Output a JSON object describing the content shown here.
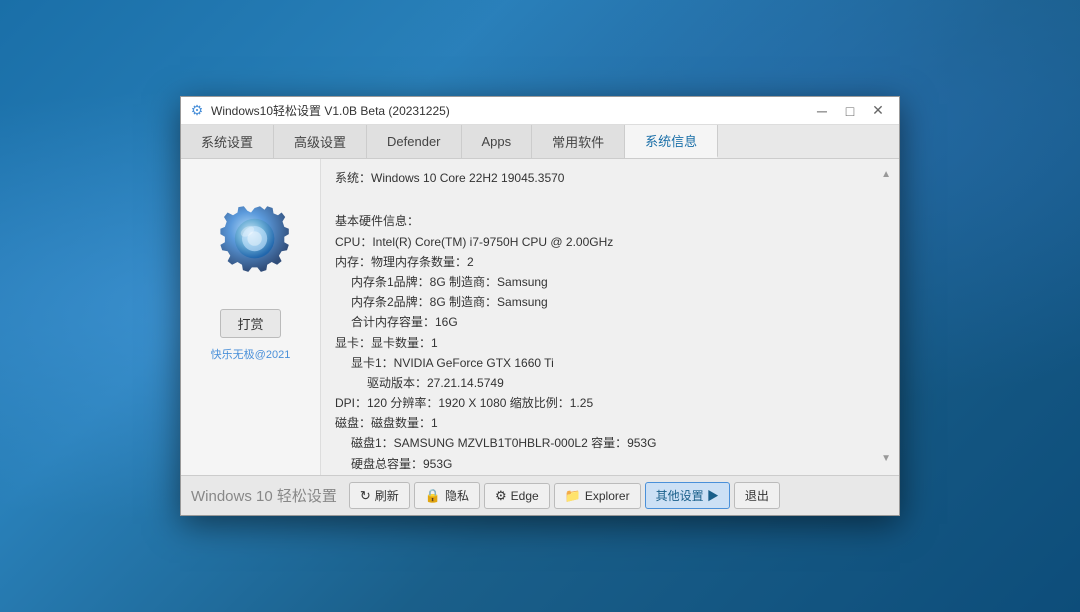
{
  "window": {
    "title": "Windows10轻松设置 V1.0B Beta (20231225)",
    "icon": "⚙",
    "minimize_label": "─",
    "maximize_label": "□",
    "close_label": "✕"
  },
  "tabs": [
    {
      "id": "system",
      "label": "系统设置",
      "active": false
    },
    {
      "id": "advanced",
      "label": "高级设置",
      "active": false
    },
    {
      "id": "defender",
      "label": "Defender",
      "active": false
    },
    {
      "id": "apps",
      "label": "Apps",
      "active": false
    },
    {
      "id": "tools",
      "label": "常用软件",
      "active": false
    },
    {
      "id": "sysinfo",
      "label": "系统信息",
      "active": true
    }
  ],
  "left_panel": {
    "print_btn": "打赏",
    "watermark": "快乐无极@2021"
  },
  "info": {
    "system_line": "系统：Windows 10 Core 22H2 19045.3570",
    "hardware_title": "基本硬件信息：",
    "cpu_line": "CPU：Intel(R) Core(TM) i7-9750H CPU @ 2.00GHz",
    "memory_title": "内存：物理内存条数量：2",
    "mem_slot1": "内存条1品牌：8G  制造商：Samsung",
    "mem_slot2": "内存条2品牌：8G  制造商：Samsung",
    "mem_total": "合计内存容量：16G",
    "gpu_title": "显卡：显卡数量：1",
    "gpu_name": "显卡1：NVIDIA GeForce GTX 1660 Ti",
    "gpu_driver": "驱动版本：27.21.14.5749",
    "dpi_line": "DPI：120    分辨率：1920 X 1080    缩放比例：1.25",
    "disk_title": "磁盘：磁盘数量：1",
    "disk_name": "磁盘1：SAMSUNG MZVLB1T0HBLR-000L2  容量：953G",
    "disk_total": "硬盘总容量：953G"
  },
  "bottom_bar": {
    "app_title": "Windows 10 轻松设置",
    "buttons": [
      {
        "id": "refresh",
        "icon": "↻",
        "label": "刷新"
      },
      {
        "id": "privacy",
        "icon": "●",
        "label": "隐私"
      },
      {
        "id": "edge",
        "icon": "◈",
        "label": "Edge"
      },
      {
        "id": "explorer",
        "icon": "▷",
        "label": "Explorer"
      },
      {
        "id": "other",
        "icon": "",
        "label": "其他设置 ▶",
        "active": true
      },
      {
        "id": "exit",
        "icon": "",
        "label": "退出"
      }
    ]
  }
}
